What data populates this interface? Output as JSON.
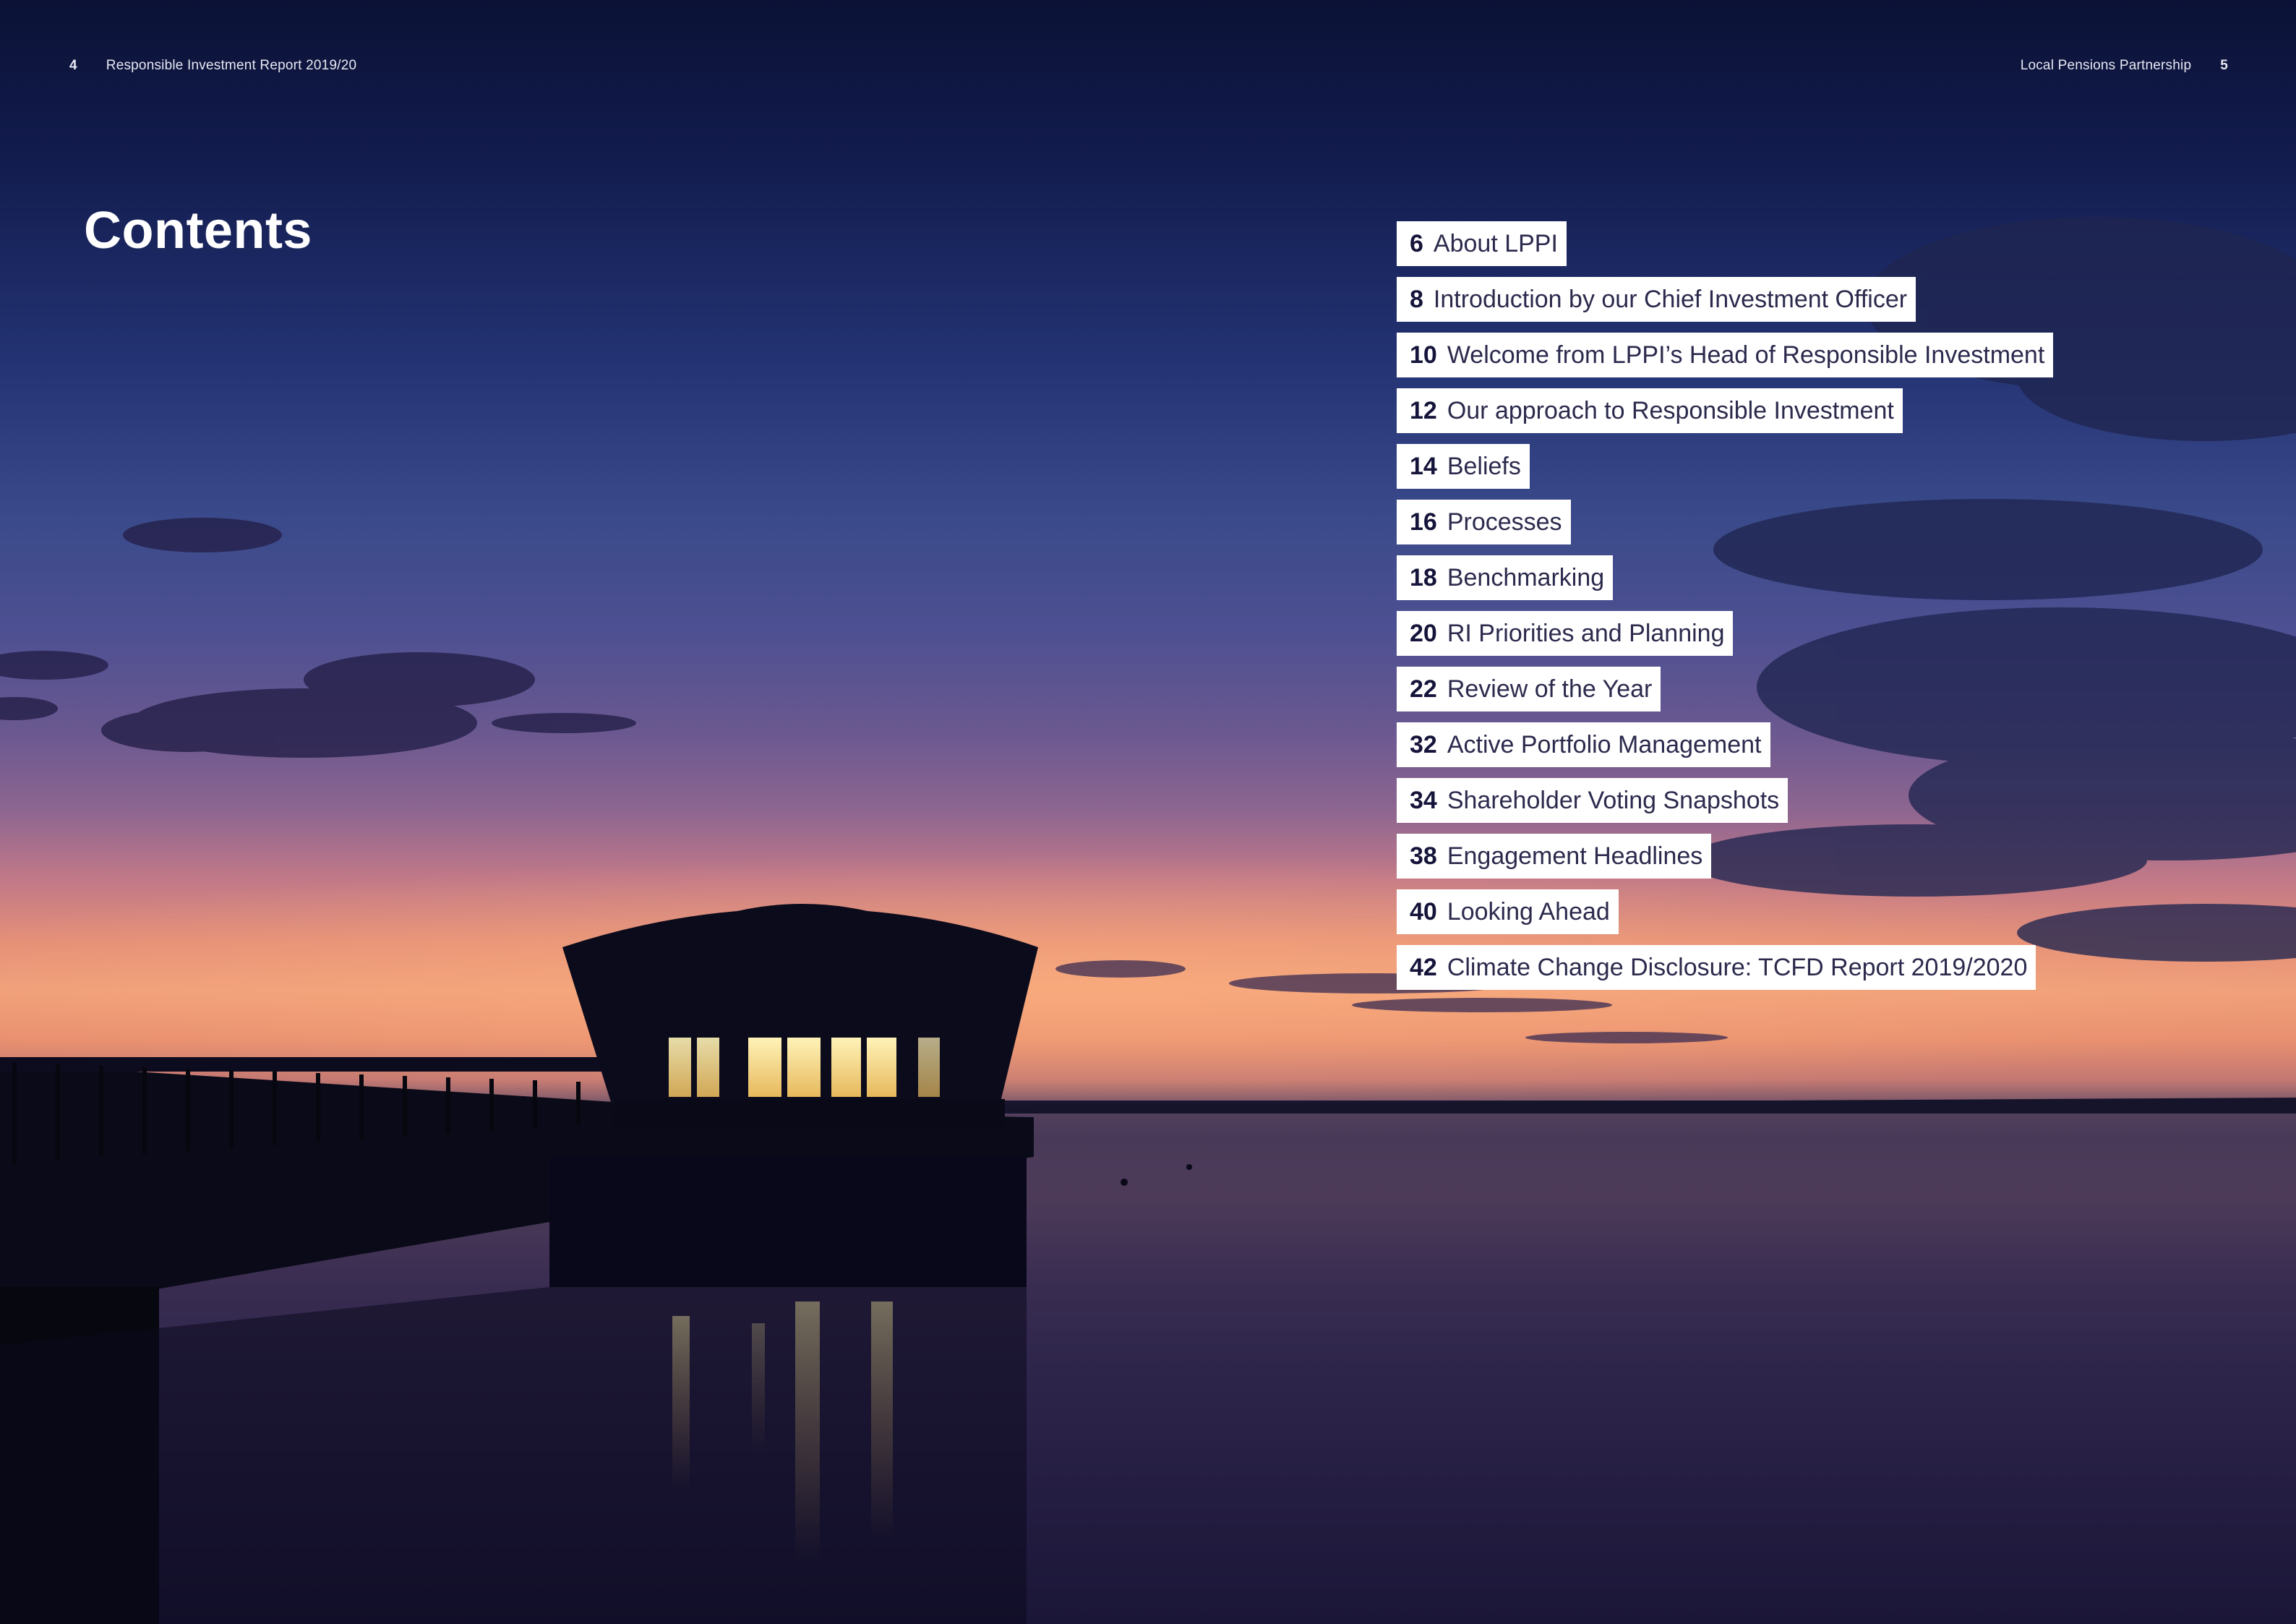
{
  "header": {
    "left_page_number": "4",
    "left_title": "Responsible Investment Report 2019/20",
    "right_title": "Local Pensions Partnership",
    "right_page_number": "5"
  },
  "contents": {
    "heading": "Contents",
    "items": [
      {
        "page": "6",
        "title": "About LPPI"
      },
      {
        "page": "8",
        "title": "Introduction by our Chief Investment Officer"
      },
      {
        "page": "10",
        "title": "Welcome from LPPI’s Head of Responsible Investment"
      },
      {
        "page": "12",
        "title": "Our approach to Responsible Investment"
      },
      {
        "page": "14",
        "title": "Beliefs"
      },
      {
        "page": "16",
        "title": "Processes"
      },
      {
        "page": "18",
        "title": "Benchmarking"
      },
      {
        "page": "20",
        "title": "RI Priorities and Planning"
      },
      {
        "page": "22",
        "title": "Review of the Year"
      },
      {
        "page": "32",
        "title": "Active Portfolio Management"
      },
      {
        "page": "34",
        "title": "Shareholder Voting Snapshots"
      },
      {
        "page": "38",
        "title": "Engagement Headlines"
      },
      {
        "page": "40",
        "title": "Looking Ahead"
      },
      {
        "page": "42",
        "title": "Climate Change Disclosure: TCFD Report 2019/2020"
      }
    ]
  },
  "colors": {
    "sky_top": "#0b1236",
    "sky_horizon": "#f0a07a",
    "label_background": "#ffffff",
    "label_text": "#1d1b3f",
    "heading_text": "#ffffff"
  }
}
